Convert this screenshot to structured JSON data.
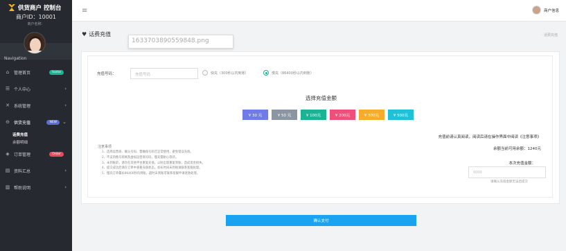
{
  "brand": {
    "title": "供货商户 控制台",
    "merchant_id": "商户ID：10001",
    "merchant_name": "商户名称："
  },
  "nav": {
    "title": "Navigation",
    "items": [
      {
        "icon": "home-icon",
        "glyph": "⌂",
        "label": "管理首页",
        "badge": "home",
        "badge_color": "#1ab394"
      },
      {
        "icon": "user-icon",
        "glyph": "☰",
        "label": "个人中心"
      },
      {
        "icon": "shuffle-icon",
        "glyph": "✕",
        "label": "系统管理"
      },
      {
        "icon": "box-icon",
        "glyph": "⊖",
        "label": "供货充值",
        "badge": "NEW",
        "badge_color": "#5a6fd6"
      },
      {
        "icon": "cube-icon",
        "glyph": "◈",
        "label": "订单管理",
        "badge": "Order",
        "badge_color": "#e8495b"
      },
      {
        "icon": "doc-icon",
        "glyph": "▤",
        "label": "资料汇总"
      },
      {
        "icon": "book-icon",
        "glyph": "▥",
        "label": "帮助说明"
      }
    ],
    "sub_items": [
      "话费充值",
      "余额明细"
    ]
  },
  "topbar": {
    "user_label": "商户信息"
  },
  "page": {
    "title": "话费充值",
    "breadcrumb": "· 话费充值",
    "tooltip_filename": "1633703890559848.png"
  },
  "form": {
    "phone_label": "充值号码：",
    "phone_placeholder": "充值号码",
    "option_fast": "快充（300秒以内到账）",
    "option_slow": "慢充（86400秒以内到账）",
    "amount_title": "选择充值金额",
    "amounts": [
      {
        "label": "¥ 30 元",
        "color": "#6f7be6"
      },
      {
        "label": "¥ 50 元",
        "color": "#8c96a3"
      },
      {
        "label": "¥ 100元",
        "color": "#1ab394"
      },
      {
        "label": "¥ 200元",
        "color": "#ef4f7a"
      },
      {
        "label": "¥ 300元",
        "color": "#f8ac2c"
      },
      {
        "label": "¥ 500元",
        "color": "#1fc1d9"
      }
    ],
    "notes_title": "注意事项",
    "notes": [
      "1、选择运营商、确认号码、需确保号码可正常使用，避免错误充值。",
      "2、不支持携号转网及虚拟运营商号码，慢充需耐心等待。",
      "3、未到账前，请勿在其他平台重复充值，以防出现重复到账，造成资金损失。",
      "4、提交成功后请在订单中查看充值状态，如长时间未到账请联系客服处理。",
      "5、慢充订单最长86400秒内到账，超时未到账可联系客服申请退款处理。"
    ],
    "right_notice": "充值前请认真阅读，阅读后请在操作界面中阅读《注意事项》",
    "balance_text": "余额当前可用余额：1240元",
    "pay_label": "本次充值金额：",
    "pay_placeholder": "0000",
    "pay_hint": "请确认充值金额无误后提交",
    "confirm_label": "确认支付"
  }
}
